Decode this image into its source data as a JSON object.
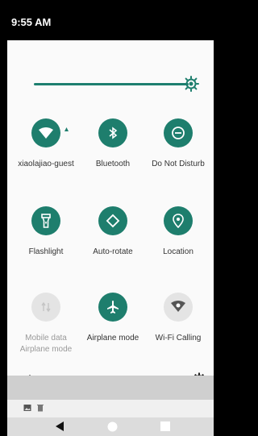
{
  "status": {
    "time": "9:55 AM"
  },
  "brightness": {
    "level": 1.0
  },
  "tiles": [
    {
      "label": "xiaolajiao-guest",
      "icon": "wifi-icon",
      "state": "on"
    },
    {
      "label": "Bluetooth",
      "icon": "bluetooth-icon",
      "state": "on"
    },
    {
      "label": "Do Not Disturb",
      "icon": "do-not-disturb-icon",
      "state": "on"
    },
    {
      "label": "Flashlight",
      "icon": "flashlight-icon",
      "state": "on"
    },
    {
      "label": "Auto-rotate",
      "icon": "auto-rotate-icon",
      "state": "on"
    },
    {
      "label": "Location",
      "icon": "location-icon",
      "state": "on"
    },
    {
      "label": "Mobile data",
      "sublabel": "Airplane mode",
      "icon": "mobile-data-icon",
      "state": "off"
    },
    {
      "label": "Airplane mode",
      "icon": "airplane-icon",
      "state": "on"
    },
    {
      "label": "Wi-Fi Calling",
      "icon": "wifi-calling-icon",
      "state": "off"
    }
  ],
  "colors": {
    "accent": "#1e7e6d",
    "panel": "#fafafa",
    "inactive": "#e4e4e4"
  }
}
